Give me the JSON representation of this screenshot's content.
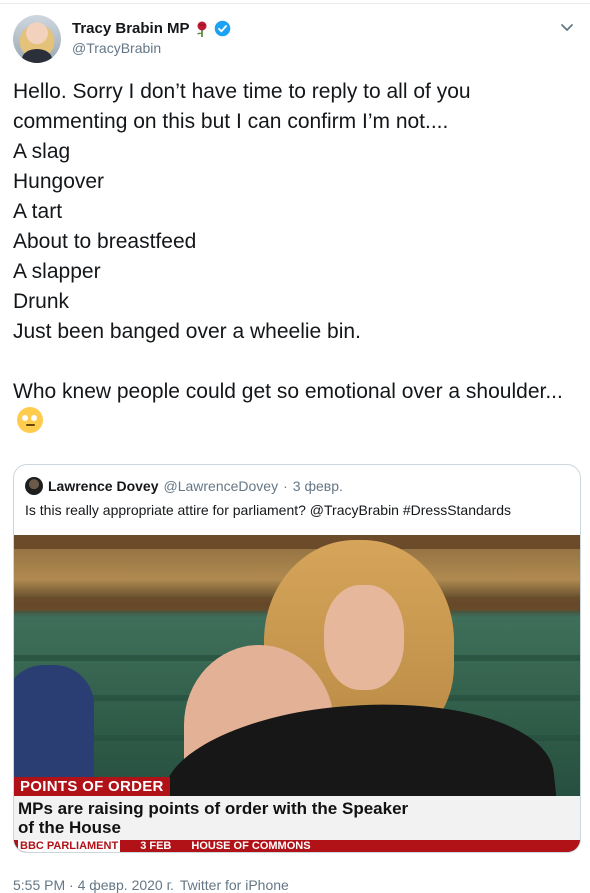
{
  "author": {
    "name": "Tracy Brabin MP",
    "handle": "@TracyBrabin"
  },
  "tweet": {
    "text": "Hello. Sorry I don’t have time to reply to all of you commenting on this but I can confirm I’m not....\nA slag\nHungover\nA tart\nAbout to breastfeed\nA slapper\nDrunk\nJust been banged over a wheelie bin.\n\nWho knew people could get so emotional over a shoulder..."
  },
  "quoted": {
    "name": "Lawrence Dovey",
    "handle": "@LawrenceDovey",
    "separator": "·",
    "date": "3 февр.",
    "text": "Is this really appropriate attire for parliament? @TracyBrabin #DressStandards",
    "media": {
      "chyron_label": "POINTS OF ORDER",
      "chyron_line1": "MPs are raising points of order with the Speaker",
      "chyron_line2": "of the House",
      "ticker": [
        "BBC PARLIAMENT",
        "3 FEB",
        "HOUSE OF COMMONS"
      ]
    }
  },
  "meta": {
    "time": "5:55 PM · 4 февр. 2020 г.",
    "source": "Twitter for iPhone"
  },
  "colors": {
    "verified": "#1da1f2",
    "chyron_red": "#b01218",
    "muted": "#657786"
  }
}
